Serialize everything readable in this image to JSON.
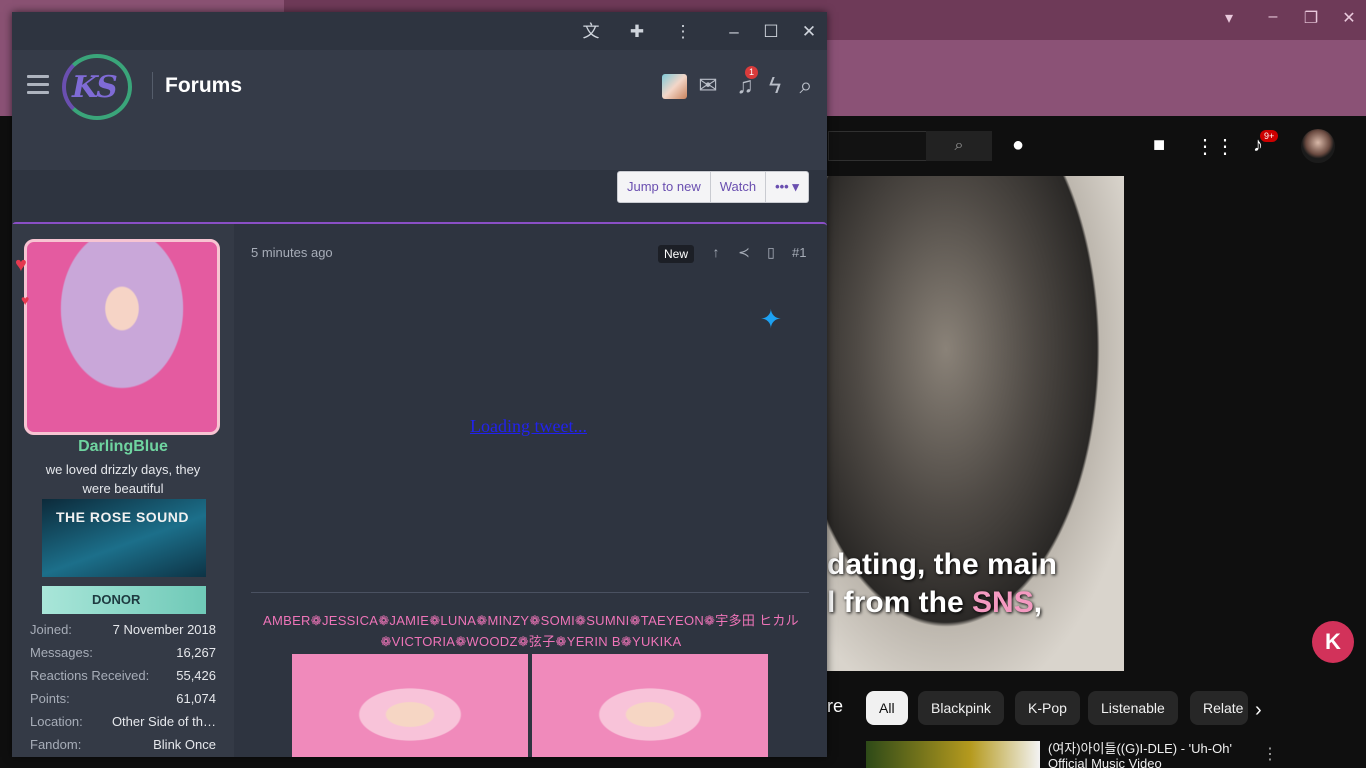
{
  "background_window": {
    "yt": {
      "caption_line1": "dating, the main",
      "caption_line2_a": "l from the ",
      "caption_line2_b": "SNS",
      "caption_line2_c": ",",
      "notif_badge": "9+",
      "k_badge": "K",
      "chips": [
        "All",
        "Blackpink",
        "K-Pop",
        "Listenable",
        "Relate"
      ],
      "partial_text": "re",
      "video_title": "(여자)아이들((G)I-DLE) - 'Uh-Oh' Official Music Video"
    }
  },
  "forum": {
    "header": {
      "title": "Forums",
      "logo_text": "KS",
      "notification_count": "1"
    },
    "buttons": {
      "jump_to_new": "Jump to new",
      "watch": "Watch",
      "more": "••• ▾"
    },
    "post": {
      "time": "5 minutes ago",
      "new_label": "New",
      "number": "#1",
      "loading_tweet": "Loading tweet...",
      "user": {
        "name": "DarlingBlue",
        "title": "we loved drizzly days, they were beautiful",
        "banner_text": "THE ROSE SOUND",
        "donor_text": "DONOR",
        "stats": [
          {
            "key": "Joined:",
            "value": "7 November 2018"
          },
          {
            "key": "Messages:",
            "value": "16,267"
          },
          {
            "key": "Reactions Received:",
            "value": "55,426"
          },
          {
            "key": "Points:",
            "value": "61,074"
          },
          {
            "key": "Location:",
            "value": "Other Side of th…"
          },
          {
            "key": "Fandom:",
            "value": "Blink Once"
          }
        ]
      },
      "signature": "AMBER❁JESSICA❁JAMIE❁LUNA❁MINZY❁SOMI❁SUMNI❁TAEYEON❁宇多田 ヒカル❁VICTORIA❁WOODZ❁弦子❁YERIN B❁YUKIKA"
    }
  },
  "colors": {
    "forum_bg": "#2e3440",
    "accent_purple": "#8a4fc6",
    "username_green": "#6fd4a0",
    "signature_pink": "#ee74b8",
    "twitter_blue": "#1da1f2"
  }
}
